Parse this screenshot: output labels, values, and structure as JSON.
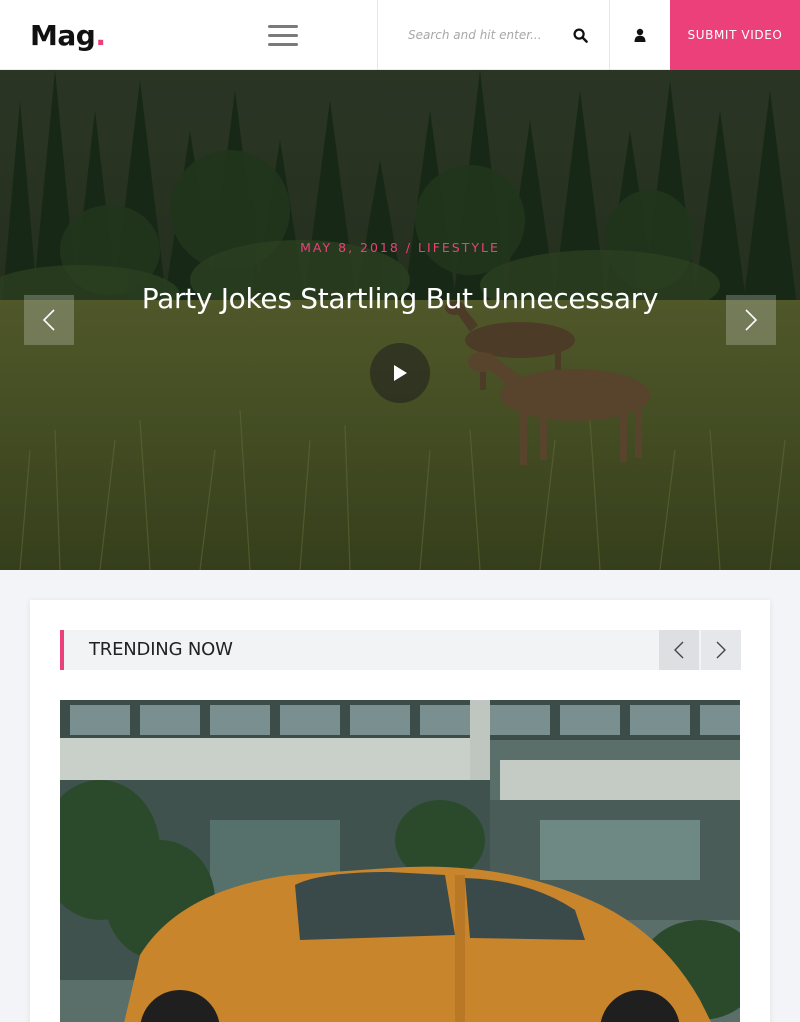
{
  "header": {
    "logo_text": "Mag",
    "logo_dot": ".",
    "search_placeholder": "Search and hit enter...",
    "submit_label": "SUBMIT VIDEO"
  },
  "hero": {
    "date": "MAY 8, 2018",
    "separator": "/",
    "category": "LIFESTYLE",
    "title": "Party Jokes Startling But Unnecessary"
  },
  "trending": {
    "title": "TRENDING NOW"
  },
  "colors": {
    "accent": "#ec407a",
    "background": "#f2f4f7"
  },
  "icons": {
    "menu": "hamburger-icon",
    "search": "search-icon",
    "user": "user-icon",
    "play": "play-icon",
    "prev": "chevron-left-icon",
    "next": "chevron-right-icon"
  }
}
